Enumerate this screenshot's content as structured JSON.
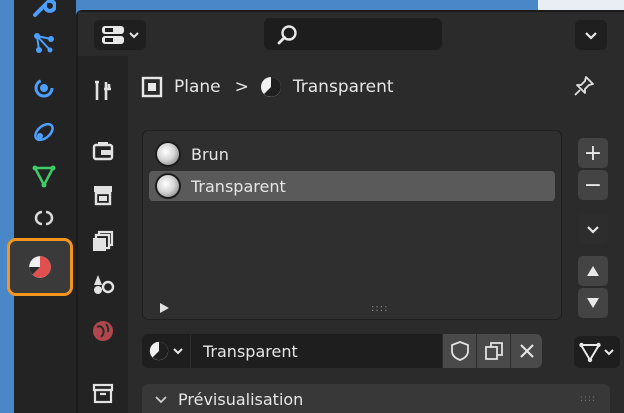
{
  "header": {
    "editor_type_icon": "editor-type-properties-icon",
    "search_icon": "search-icon",
    "dropdown_icon": "chevron-down-icon"
  },
  "outer_tabs": [
    {
      "icon": "wrench-icon"
    },
    {
      "icon": "particles-icon"
    },
    {
      "icon": "physics-icon"
    },
    {
      "icon": "constraints-icon"
    },
    {
      "icon": "object-data-mesh-icon"
    },
    {
      "icon": "modifier-link-icon"
    },
    {
      "icon": "material-icon",
      "active": true
    }
  ],
  "side_tabs": [
    {
      "icon": "tool-icon"
    },
    {
      "icon": "render-icon"
    },
    {
      "icon": "output-icon"
    },
    {
      "icon": "view-layer-icon"
    },
    {
      "icon": "scene-icon"
    },
    {
      "icon": "world-icon"
    },
    {
      "icon": "collection-icon"
    }
  ],
  "breadcrumb": {
    "object": "Plane",
    "material": "Transparent",
    "separator": ">"
  },
  "material_slots": [
    {
      "name": "Brun",
      "selected": false
    },
    {
      "name": "Transparent",
      "selected": true
    }
  ],
  "slot_buttons": {
    "add": "+",
    "remove": "−"
  },
  "material_selector": {
    "name": "Transparent"
  },
  "panels": {
    "preview_label": "Prévisualisation"
  },
  "colors": {
    "active_tab_outline": "#f3951f",
    "editor_bg": "#2b2b2b",
    "selected_slot": "#5a5a5a"
  }
}
